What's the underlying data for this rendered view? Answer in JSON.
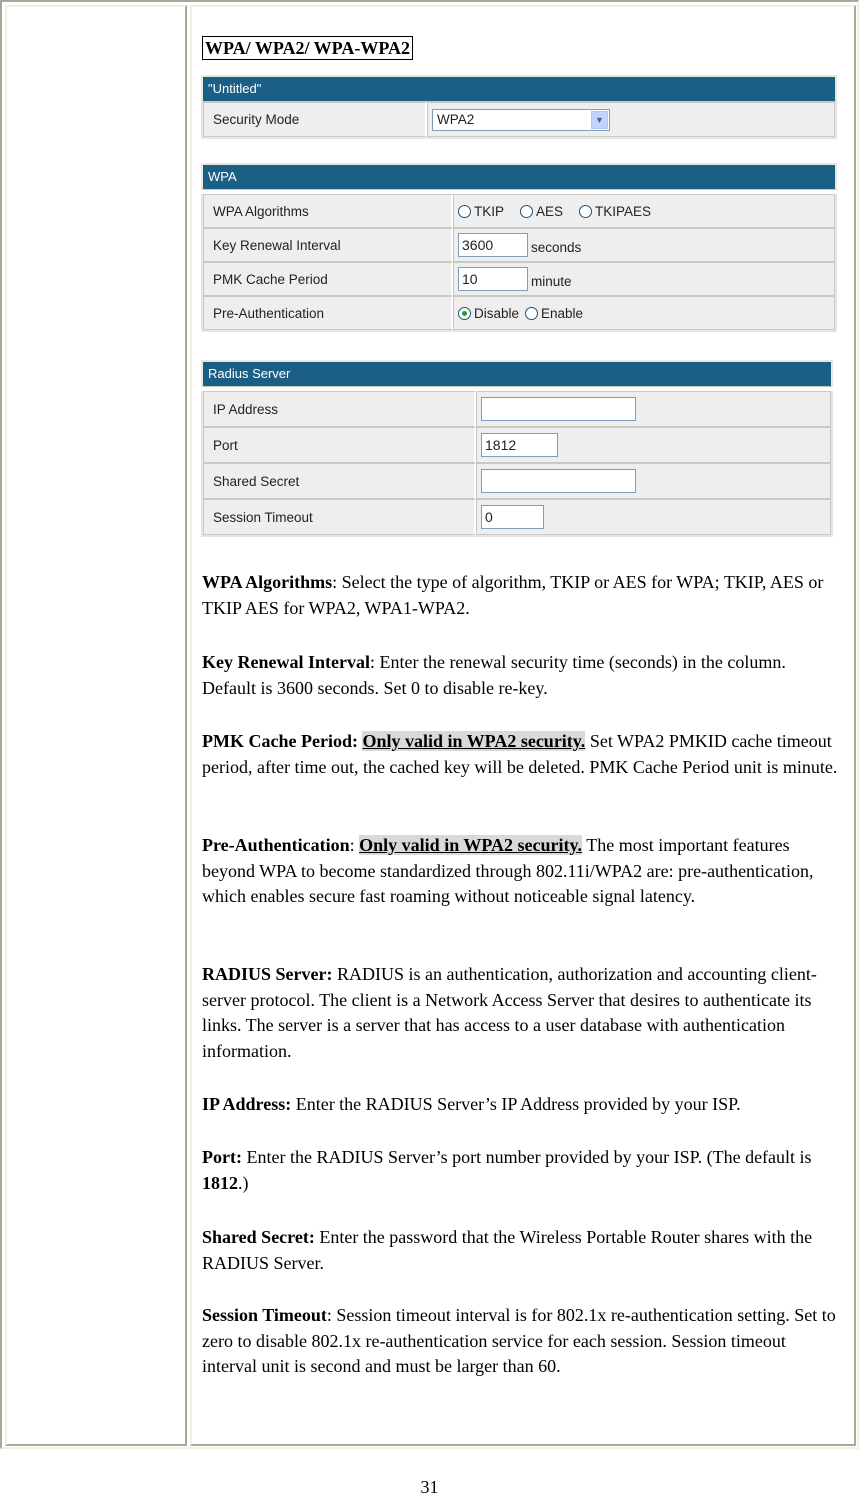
{
  "heading": "WPA/ WPA2/ WPA-WPA2",
  "panel_untitled": {
    "title": "\"Untitled\"",
    "security_mode_label": "Security Mode",
    "security_mode_value": "WPA2"
  },
  "panel_wpa": {
    "title": "WPA",
    "algorithms_label": "WPA Algorithms",
    "algorithm_options": [
      "TKIP",
      "AES",
      "TKIPAES"
    ],
    "key_renewal_label": "Key Renewal Interval",
    "key_renewal_value": "3600",
    "key_renewal_unit": "seconds",
    "pmk_label": "PMK Cache Period",
    "pmk_value": "10",
    "pmk_unit": "minute",
    "preauth_label": "Pre-Authentication",
    "preauth_options": [
      "Disable",
      "Enable"
    ],
    "preauth_selected": "Disable"
  },
  "panel_radius": {
    "title": "Radius Server",
    "ip_label": "IP Address",
    "ip_value": "",
    "port_label": "Port",
    "port_value": "1812",
    "secret_label": "Shared Secret",
    "secret_value": "",
    "timeout_label": "Session Timeout",
    "timeout_value": "0"
  },
  "descriptions": {
    "wpa_algorithms": {
      "term": "WPA Algorithms",
      "text": ": Select the type of algorithm, TKIP or AES for WPA; TKIP, AES or TKIP AES for WPA2, WPA1-WPA2."
    },
    "key_renewal": {
      "term": "Key Renewal Interval",
      "text": ": Enter the renewal security time (seconds) in the column. Default is 3600 seconds. Set 0 to disable re-key."
    },
    "pmk_cache": {
      "term": "PMK Cache Period: ",
      "highlight": "Only valid in WPA2 security.",
      "text": " Set WPA2 PMKID cache timeout period, after time out, the cached key will be deleted. PMK Cache Period unit is minute."
    },
    "pre_auth": {
      "term": "Pre-Authentication",
      "sep": ": ",
      "highlight": "Only valid in WPA2 security.",
      "text": " The most important features beyond WPA to become standardized through 802.11i/WPA2 are: pre-authentication, which enables secure fast roaming without noticeable signal latency."
    },
    "radius_server": {
      "term": "RADIUS Server:",
      "text": " RADIUS is an authentication, authorization and accounting client-server protocol. The client is a Network Access Server that desires to authenticate its links. The server is a server that has access to a user database with authentication information."
    },
    "ip_address": {
      "term": "IP Address:",
      "text": " Enter the RADIUS Server’s IP Address provided by your ISP."
    },
    "port": {
      "term": "Port:",
      "text": " Enter the RADIUS Server’s port number provided by your ISP. (The default is ",
      "bold_value": "1812",
      "text_end": ".)"
    },
    "shared_secret": {
      "term": "Shared Secret:",
      "text": " Enter the password that the Wireless Portable Router shares with the RADIUS Server."
    },
    "session_timeout": {
      "term": "Session Timeout",
      "text": ": Session timeout interval is for 802.1x re-authentication setting. Set to zero to disable 802.1x re-authentication service for each session. Session timeout interval unit is second and must be larger than 60."
    }
  },
  "page_number": "31"
}
